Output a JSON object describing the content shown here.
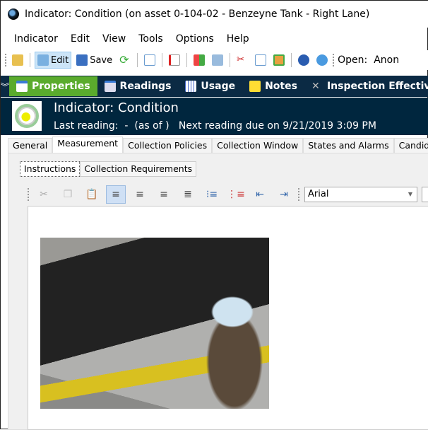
{
  "window": {
    "title": "Indicator: Condition (on asset 0-104-02 - Benzeyne Tank - Right Lane)"
  },
  "menu": [
    "Indicator",
    "Edit",
    "View",
    "Tools",
    "Options",
    "Help"
  ],
  "toolbar": {
    "edit_label": "Edit",
    "save_label": "Save",
    "open_label": "Open:",
    "open_value": "Anon"
  },
  "nav": {
    "tabs": [
      {
        "label": "Properties",
        "icon": "window-icon",
        "active": true
      },
      {
        "label": "Readings",
        "icon": "chart-icon"
      },
      {
        "label": "Usage",
        "icon": "grid-icon"
      },
      {
        "label": "Notes",
        "icon": "note-icon"
      },
      {
        "label": "Inspection Effectiv",
        "icon": "tools-icon"
      }
    ]
  },
  "header": {
    "title": "Indicator: Condition",
    "subtitle": "Last reading:  -  (as of )   Next reading due on 9/21/2019 3:09 PM"
  },
  "tabs": [
    "General",
    "Measurement",
    "Collection Policies",
    "Collection Window",
    "States and Alarms",
    "Candidate"
  ],
  "active_tab": "Measurement",
  "subtabs": [
    "Instructions",
    "Collection Requirements"
  ],
  "editor": {
    "font": "Arial"
  },
  "colors": {
    "nav_bg": "#0b2a44",
    "active_nav": "#5aab2d",
    "header_bg": "#00263e"
  }
}
